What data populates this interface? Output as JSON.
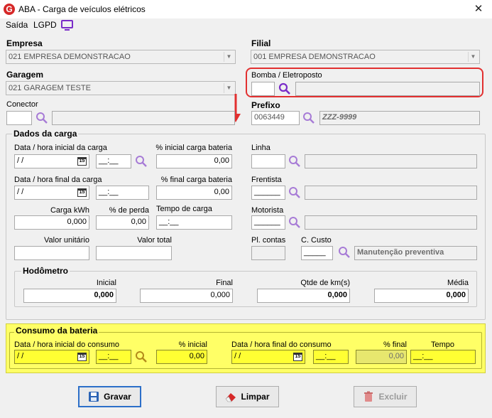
{
  "window": {
    "title": "ABA - Carga de veículos elétricos",
    "logo_letter": "G",
    "close": "✕"
  },
  "menu": {
    "saida": "Saída",
    "lgpd": "LGPD"
  },
  "header": {
    "empresa_label": "Empresa",
    "empresa_value": "021 EMPRESA DEMONSTRACAO",
    "filial_label": "Filial",
    "filial_value": "001 EMPRESA DEMONSTRACAO",
    "garagem_label": "Garagem",
    "garagem_value": "021 GARAGEM TESTE",
    "bomba_label": "Bomba / Eletroposto",
    "conector_label": "Conector",
    "prefixo_label": "Prefixo",
    "prefixo_value": "0063449",
    "prefixo_desc": "ZZZ-9999"
  },
  "dados": {
    "title": "Dados da carga",
    "data_inicial_label": "Data / hora inicial da carga",
    "data_inicial_value": " / /",
    "hora_inicial_value": "__:__",
    "pct_inicial_label": "% inicial carga bateria",
    "pct_inicial_value": "0,00",
    "linha_label": "Linha",
    "data_final_label": "Data / hora final da carga",
    "data_final_value": " / /",
    "hora_final_value": "__:__",
    "pct_final_label": "% final carga bateria",
    "pct_final_value": "0,00",
    "frentista_label": "Frentista",
    "frentista_value": "______",
    "carga_kwh_label": "Carga kWh",
    "carga_kwh_value": "0,000",
    "pct_perda_label": "% de perda",
    "pct_perda_value": "0,00",
    "tempo_label": "Tempo de carga",
    "tempo_value": "__:__",
    "motorista_label": "Motorista",
    "motorista_value": "______",
    "valor_unit_label": "Valor unitário",
    "valor_total_label": "Valor total",
    "pl_contas_label": "Pl. contas",
    "c_custo_label": "C. Custo",
    "c_custo_value": "_____",
    "c_custo_desc": "Manutenção preventiva"
  },
  "hodometro": {
    "title": "Hodômetro",
    "inicial_label": "Inicial",
    "inicial_value": "0,000",
    "final_label": "Final",
    "final_value": "0,000",
    "km_label": "Qtde de km(s)",
    "km_value": "0,000",
    "media_label": "Média",
    "media_value": "0,000"
  },
  "consumo": {
    "title": "Consumo da bateria",
    "data_inicial_label": "Data / hora inicial do consumo",
    "data_inicial_value": " / /",
    "hora_inicial_value": "__:__",
    "pct_inicial_label": "% inicial",
    "pct_inicial_value": "0,00",
    "data_final_label": "Data / hora final do consumo",
    "data_final_value": " / /",
    "hora_final_value": "__:__",
    "pct_final_label": "% final",
    "pct_final_value": "0,00",
    "tempo_label": "Tempo",
    "tempo_value": "__:__"
  },
  "buttons": {
    "gravar": "Gravar",
    "limpar": "Limpar",
    "excluir": "Excluir"
  },
  "calendar_glyph": "15",
  "colors": {
    "accent_purple": "#7a2cc8",
    "highlight_red": "#e23030",
    "highlight_yellow": "#ffff66"
  }
}
